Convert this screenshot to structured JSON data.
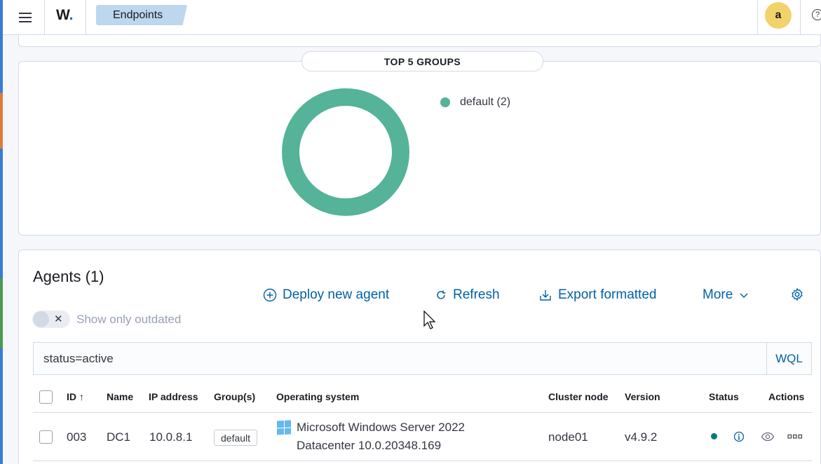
{
  "header": {
    "logo_text": "W",
    "logo_dot": ".",
    "breadcrumb": "Endpoints",
    "avatar_initial": "a",
    "help_glyph": "?"
  },
  "chart_panel": {
    "title": "TOP 5 GROUPS",
    "legend": [
      {
        "label": "default (2)",
        "color": "#54b399"
      }
    ]
  },
  "chart_data": {
    "type": "pie",
    "title": "TOP 5 GROUPS",
    "categories": [
      "default"
    ],
    "values": [
      2
    ],
    "colors": [
      "#54b399"
    ],
    "legend_position": "top-right",
    "donut": true
  },
  "agents": {
    "title": "Agents (1)",
    "actions": {
      "deploy": "Deploy new agent",
      "refresh": "Refresh",
      "export": "Export formatted",
      "more": "More"
    },
    "toggle_label": "Show only outdated",
    "search_value": "status=active",
    "wql_label": "WQL",
    "columns": [
      "ID",
      "Name",
      "IP address",
      "Group(s)",
      "Operating system",
      "Cluster node",
      "Version",
      "Status",
      "Actions"
    ],
    "sort_indicator": "↑",
    "rows": [
      {
        "id": "003",
        "name": "DC1",
        "ip": "10.0.8.1",
        "group": "default",
        "os_line1": "Microsoft Windows Server 2022",
        "os_line2": "Datacenter 10.0.20348.169",
        "node": "node01",
        "version": "v4.9.2",
        "status_color": "#017d73"
      }
    ]
  },
  "accent_color": "#0061a6"
}
